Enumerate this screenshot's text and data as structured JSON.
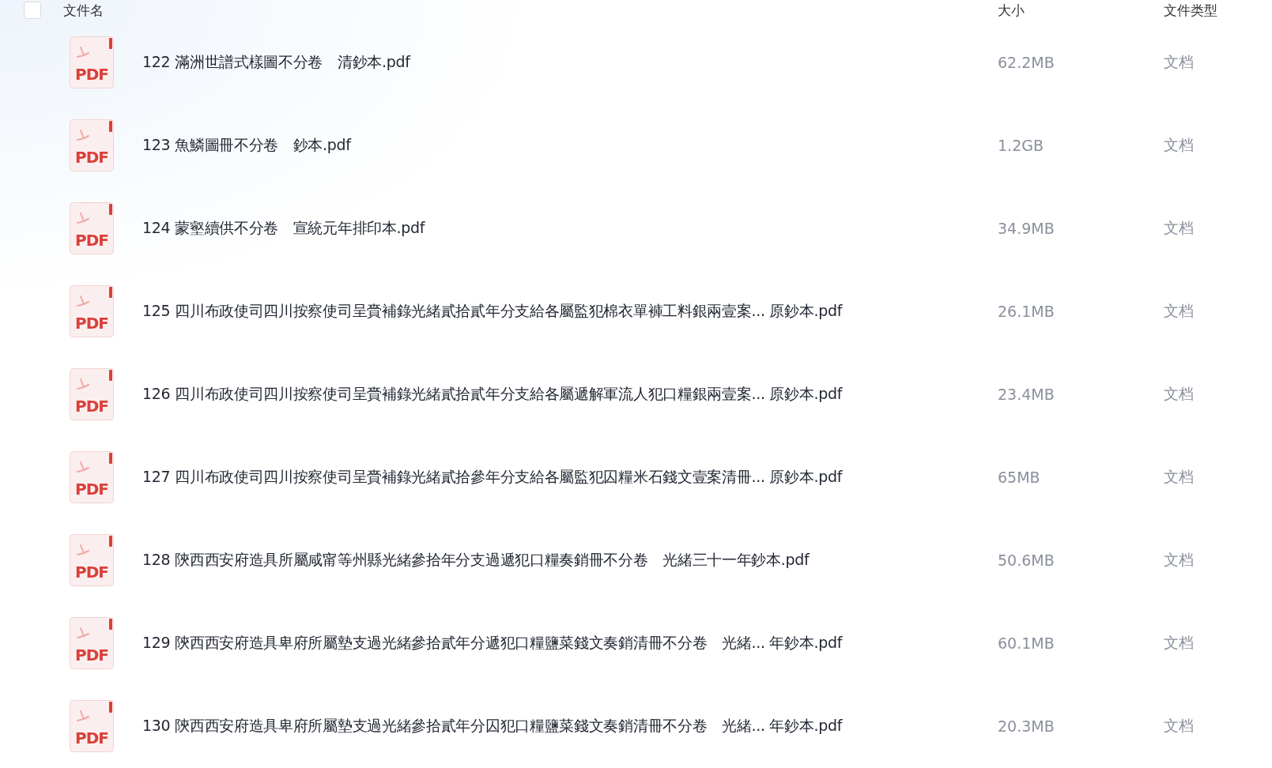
{
  "header": {
    "select_all": {
      "checked": false
    },
    "columns": [
      "文件名",
      "大小",
      "文件类型"
    ]
  },
  "files": [
    {
      "icon_label": "PDF",
      "name": "122 滿洲世譜式樣圖不分卷　清鈔本.pdf",
      "size": "62.2MB",
      "type": "文档"
    },
    {
      "icon_label": "PDF",
      "name": "123 魚鱗圖冊不分卷　鈔本.pdf",
      "size": "1.2GB",
      "type": "文档"
    },
    {
      "icon_label": "PDF",
      "name": "124 蒙壑續供不分卷　宣統元年排印本.pdf",
      "size": "34.9MB",
      "type": "文档"
    },
    {
      "icon_label": "PDF",
      "name": "125 四川布政使司四川按察使司呈賫補錄光緒貳拾貳年分支給各屬監犯棉衣單褲工料銀兩壹案... 原鈔本.pdf",
      "size": "26.1MB",
      "type": "文档"
    },
    {
      "icon_label": "PDF",
      "name": "126 四川布政使司四川按察使司呈賫補錄光緒貳拾貳年分支給各屬遞解軍流人犯口糧銀兩壹案... 原鈔本.pdf",
      "size": "23.4MB",
      "type": "文档"
    },
    {
      "icon_label": "PDF",
      "name": "127 四川布政使司四川按察使司呈賫補錄光緒貳拾參年分支給各屬監犯囚糧米石錢文壹案清冊... 原鈔本.pdf",
      "size": "65MB",
      "type": "文档"
    },
    {
      "icon_label": "PDF",
      "name": "128 陝西西安府造具所屬咸甯等州縣光緒參拾年分支過遞犯口糧奏銷冊不分卷　光緒三十一年鈔本.pdf",
      "size": "50.6MB",
      "type": "文档"
    },
    {
      "icon_label": "PDF",
      "name": "129 陝西西安府造具卑府所屬墊支過光緒參拾貳年分遞犯口糧鹽菜錢文奏銷清冊不分卷　光緒... 年鈔本.pdf",
      "size": "60.1MB",
      "type": "文档"
    },
    {
      "icon_label": "PDF",
      "name": "130 陝西西安府造具卑府所屬墊支過光緒參拾貳年分囚犯口糧鹽菜錢文奏銷清冊不分卷　光緒... 年鈔本.pdf",
      "size": "20.3MB",
      "type": "文档"
    }
  ]
}
